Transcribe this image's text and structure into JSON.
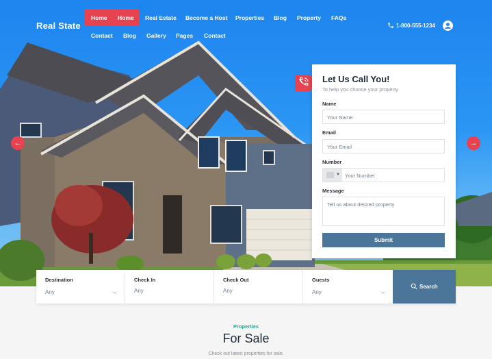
{
  "brand": {
    "logo": "Real State",
    "accent": "#e7424f",
    "primary": "#4b7599"
  },
  "nav": {
    "row1": [
      "Home",
      "Home",
      "Real Estate",
      "Become a Host",
      "Properties",
      "Blog",
      "Property",
      "FAQs"
    ],
    "row2": [
      "Contact",
      "Blog",
      "Gallery",
      "Pages",
      "Contact"
    ]
  },
  "header": {
    "phone": "1-800-555-1234",
    "phone_icon": "phone-icon",
    "user_icon": "user-icon"
  },
  "hero": {
    "prev_icon": "arrow-left-icon",
    "next_icon": "arrow-right-icon"
  },
  "callback_form": {
    "title": "Let Us Call You!",
    "subtitle": "To help you choose your property",
    "name_label": "Name",
    "name_placeholder": "Your Name",
    "email_label": "Email",
    "email_placeholder": "Your Email",
    "number_label": "Number",
    "number_placeholder": "Your Number",
    "message_label": "Message",
    "message_placeholder": "Tell us about desired property",
    "submit_label": "Submit"
  },
  "search": {
    "fields": [
      {
        "label": "Destination",
        "value": "Any"
      },
      {
        "label": "Check In",
        "value": "Any"
      },
      {
        "label": "Check Out",
        "value": "Any"
      },
      {
        "label": "Guests",
        "value": "Any"
      }
    ],
    "button_label": "Search"
  },
  "section": {
    "kicker": "Properties",
    "title": "For Sale",
    "subtitle": "Check out latest properties for sale."
  }
}
